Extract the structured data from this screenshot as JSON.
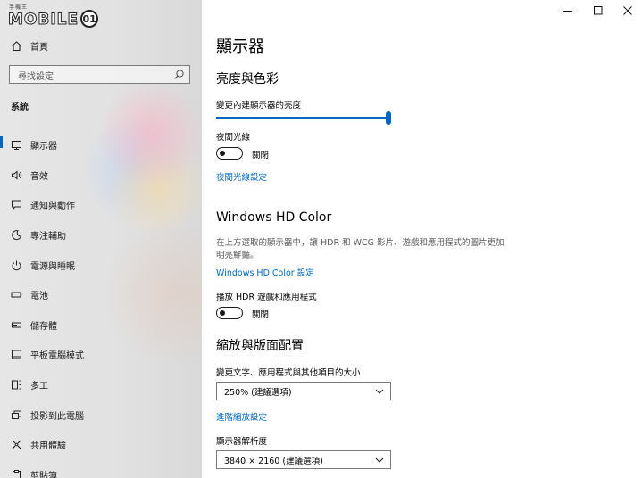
{
  "watermark": {
    "small": "手機王",
    "brand": "MOBILE",
    "mark": "01"
  },
  "sidebar": {
    "home_label": "首頁",
    "search_placeholder": "尋找設定",
    "section_title": "系統",
    "items": [
      {
        "label": "顯示器",
        "icon": "monitor-icon",
        "selected": true
      },
      {
        "label": "音效",
        "icon": "speaker-icon"
      },
      {
        "label": "通知與動作",
        "icon": "notification-icon"
      },
      {
        "label": "專注輔助",
        "icon": "moon-icon"
      },
      {
        "label": "電源與睡眠",
        "icon": "power-icon"
      },
      {
        "label": "電池",
        "icon": "battery-icon"
      },
      {
        "label": "儲存體",
        "icon": "storage-icon"
      },
      {
        "label": "平板電腦模式",
        "icon": "tablet-icon"
      },
      {
        "label": "多工",
        "icon": "multitask-icon"
      },
      {
        "label": "投影到此電腦",
        "icon": "project-icon"
      },
      {
        "label": "共用體驗",
        "icon": "shared-icon"
      },
      {
        "label": "剪貼簿",
        "icon": "clipboard-icon"
      }
    ]
  },
  "main": {
    "title": "顯示器",
    "brightness_section": "亮度與色彩",
    "brightness_label": "變更內建顯示器的亮度",
    "brightness_value_percent": 100,
    "night_light_label": "夜間光線",
    "night_light_state": "關閉",
    "night_light_link": "夜間光線設定",
    "hd_color_section": "Windows HD Color",
    "hd_color_desc": "在上方選取的顯示器中，讓 HDR 和 WCG 影片、遊戲和應用程式的圖片更加明亮鮮豔。",
    "hd_color_link": "Windows HD Color 設定",
    "hdr_label": "播放 HDR 遊戲和應用程式",
    "hdr_state": "關閉",
    "scale_section": "縮放與版面配置",
    "scale_label": "變更文字、應用程式與其他項目的大小",
    "scale_value": "250% (建議選項)",
    "advanced_scaling_link": "進階縮放設定",
    "resolution_label": "顯示器解析度",
    "resolution_value": "3840 × 2160 (建議選項)"
  },
  "colors": {
    "accent": "#0067c0",
    "text": "#000000",
    "secondary_text": "#5a5a5a"
  }
}
